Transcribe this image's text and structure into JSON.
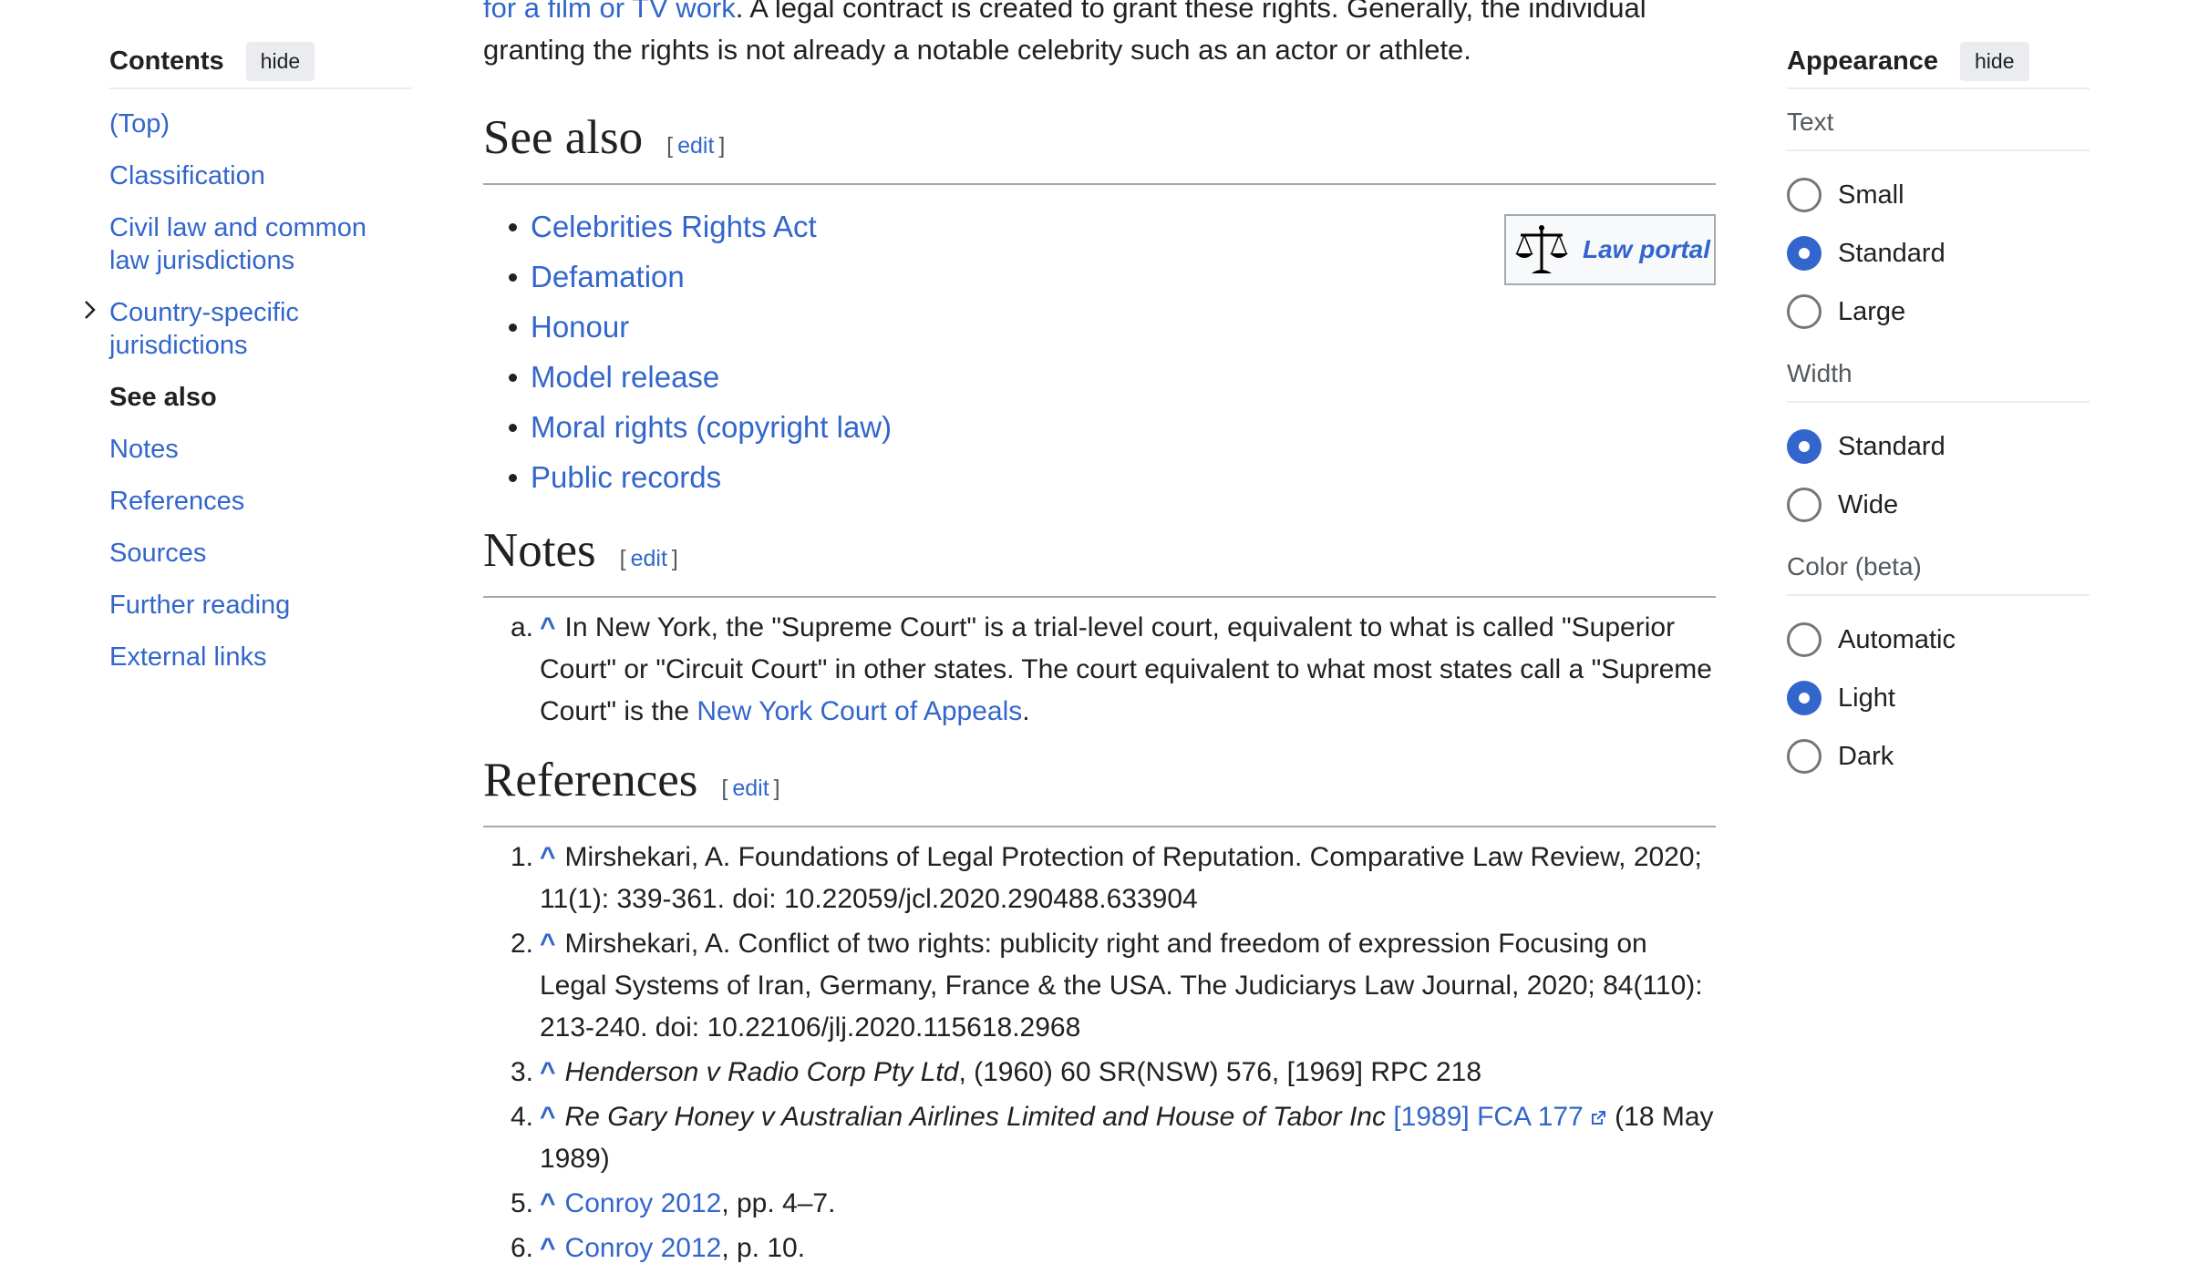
{
  "toc": {
    "title": "Contents",
    "hide_label": "hide",
    "items": [
      {
        "label": "(Top)"
      },
      {
        "label": "Classification"
      },
      {
        "label": "Civil law and common law jurisdictions"
      },
      {
        "label": "Country-specific jurisdictions"
      },
      {
        "label": "See also"
      },
      {
        "label": "Notes"
      },
      {
        "label": "References"
      },
      {
        "label": "Sources"
      },
      {
        "label": "Further reading"
      },
      {
        "label": "External links"
      }
    ]
  },
  "main": {
    "intro": {
      "link_text": "for a film or TV work",
      "text": ". A legal contract is created to grant these rights. Generally, the individual granting the rights is not already a notable celebrity such as an actor or athlete."
    },
    "see_also": {
      "heading": "See also",
      "edit_label": "edit",
      "items": [
        {
          "label": "Celebrities Rights Act"
        },
        {
          "label": "Defamation"
        },
        {
          "label": "Honour"
        },
        {
          "label": "Model release"
        },
        {
          "label": "Moral rights (copyright law)"
        },
        {
          "label": "Public records"
        }
      ],
      "portal_label": "Law portal"
    },
    "notes": {
      "heading": "Notes",
      "edit_label": "edit",
      "items": [
        {
          "marker": "a.",
          "caret": "^",
          "text": "In New York, the \"Supreme Court\" is a trial-level court, equivalent to what is called \"Superior Court\" or \"Circuit Court\" in other states. The court equivalent to what most states call a \"Supreme Court\" is the ",
          "link": "New York Court of Appeals",
          "tail": "."
        }
      ]
    },
    "references": {
      "heading": "References",
      "edit_label": "edit",
      "items": [
        {
          "marker": "1.",
          "caret": "^",
          "text": "Mirshekari, A. Foundations of Legal Protection of Reputation. Comparative Law Review, 2020; 11(1): 339-361. doi: 10.22059/jcl.2020.290488.633904"
        },
        {
          "marker": "2.",
          "caret": "^",
          "text": "Mirshekari, A. Conflict of two rights: publicity right and freedom of expression Focusing on Legal Systems of Iran, Germany, France & the USA. The Judiciarys Law Journal, 2020; 84(110): 213-240. doi: 10.22106/jlj.2020.115618.2968"
        },
        {
          "marker": "3.",
          "caret": "^",
          "italic": "Henderson v Radio Corp Pty Ltd",
          "text": ", (1960) 60 SR(NSW) 576, [1969] RPC 218"
        },
        {
          "marker": "4.",
          "caret": "^",
          "italic": "Re Gary Honey v Australian Airlines Limited and House of Tabor Inc",
          "link": "[1989] FCA 177",
          "text": " (18 May 1989)"
        },
        {
          "marker": "5.",
          "caret": "^",
          "link": "Conroy 2012",
          "text": ", pp. 4–7."
        },
        {
          "marker": "6.",
          "caret": "^",
          "link": "Conroy 2012",
          "text": ", p. 10."
        }
      ]
    }
  },
  "appearance": {
    "title": "Appearance",
    "hide_label": "hide",
    "text_group": {
      "label": "Text",
      "options": [
        {
          "label": "Small",
          "selected": false
        },
        {
          "label": "Standard",
          "selected": true
        },
        {
          "label": "Large",
          "selected": false
        }
      ]
    },
    "width_group": {
      "label": "Width",
      "options": [
        {
          "label": "Standard",
          "selected": true
        },
        {
          "label": "Wide",
          "selected": false
        }
      ]
    },
    "color_group": {
      "label": "Color (beta)",
      "options": [
        {
          "label": "Automatic",
          "selected": false
        },
        {
          "label": "Light",
          "selected": true
        },
        {
          "label": "Dark",
          "selected": false
        }
      ]
    }
  },
  "colors": {
    "link": "#3366cc",
    "text": "#202122",
    "radio_selected": "#3366cc"
  }
}
